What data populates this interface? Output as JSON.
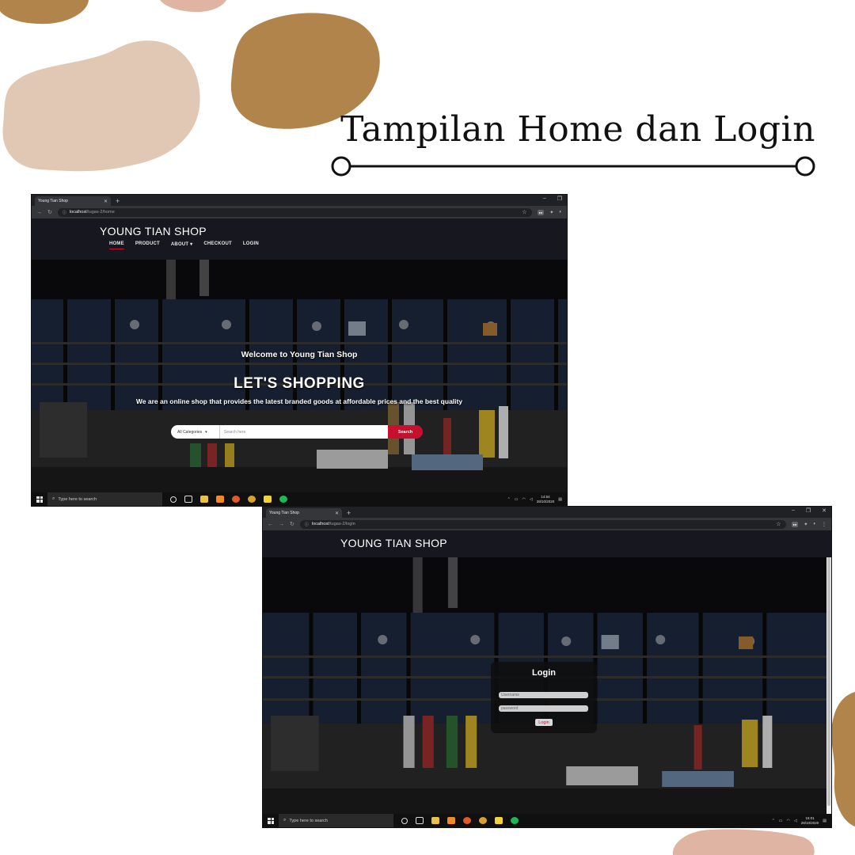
{
  "slide": {
    "title": "Tampilan Home dan Login"
  },
  "colors": {
    "blob_brown": "#b0844b",
    "blob_beige": "#e0c8b4",
    "blob_pink": "#dfb4a2",
    "accent_red": "#c8102e",
    "header_dark": "#17181f"
  },
  "home_window": {
    "tab_title": "Young Tian Shop",
    "url_host": "localhost",
    "url_path": "/tugas-2/home",
    "brand": "YOUNG TIAN SHOP",
    "nav": [
      "HOME",
      "PRODUCT",
      "ABOUT ▾",
      "CHECKOUT",
      "LOGIN"
    ],
    "active_nav": "HOME",
    "hero": {
      "welcome": "Welcome to Young Tian Shop",
      "headline": "LET'S SHOPPING",
      "tagline": "We are an online shop that provides the latest branded goods at affordable prices and the best quality"
    },
    "search": {
      "category": "All Categories",
      "placeholder": "Search here",
      "button": "Search"
    },
    "taskbar": {
      "search_text": "Type here to search",
      "time": "14:54",
      "date": "28/10/2020"
    }
  },
  "login_window": {
    "tab_title": "Young Tian Shop",
    "url_host": "localhost",
    "url_path": "/tugas-2/login",
    "brand": "YOUNG TIAN SHOP",
    "form": {
      "title": "Login",
      "username_placeholder": "Username",
      "password_placeholder": "password",
      "button": "Login"
    },
    "taskbar": {
      "search_text": "Type here to search",
      "time": "15:01",
      "date": "28/10/2020"
    }
  }
}
